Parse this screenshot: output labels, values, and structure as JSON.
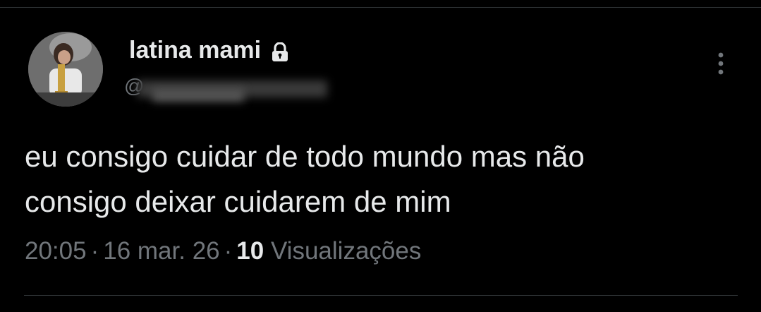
{
  "tweet": {
    "author": {
      "display_name": "latina mami",
      "handle_prefix": "@",
      "protected_icon": "lock-icon",
      "avatar": "avatar-photo"
    },
    "text_line_1": "eu consigo cuidar de todo mundo mas não",
    "text_line_2": "consigo deixar cuidarem de mim",
    "time": "20:05",
    "separator": "·",
    "date": "16 mar. 26",
    "views_count": "10",
    "views_label": "Visualizações",
    "more_icon": "more-vertical-icon"
  },
  "colors": {
    "background": "#000000",
    "primary_text": "#e7e9ea",
    "secondary_text": "#71767b",
    "border": "#2f3336"
  }
}
